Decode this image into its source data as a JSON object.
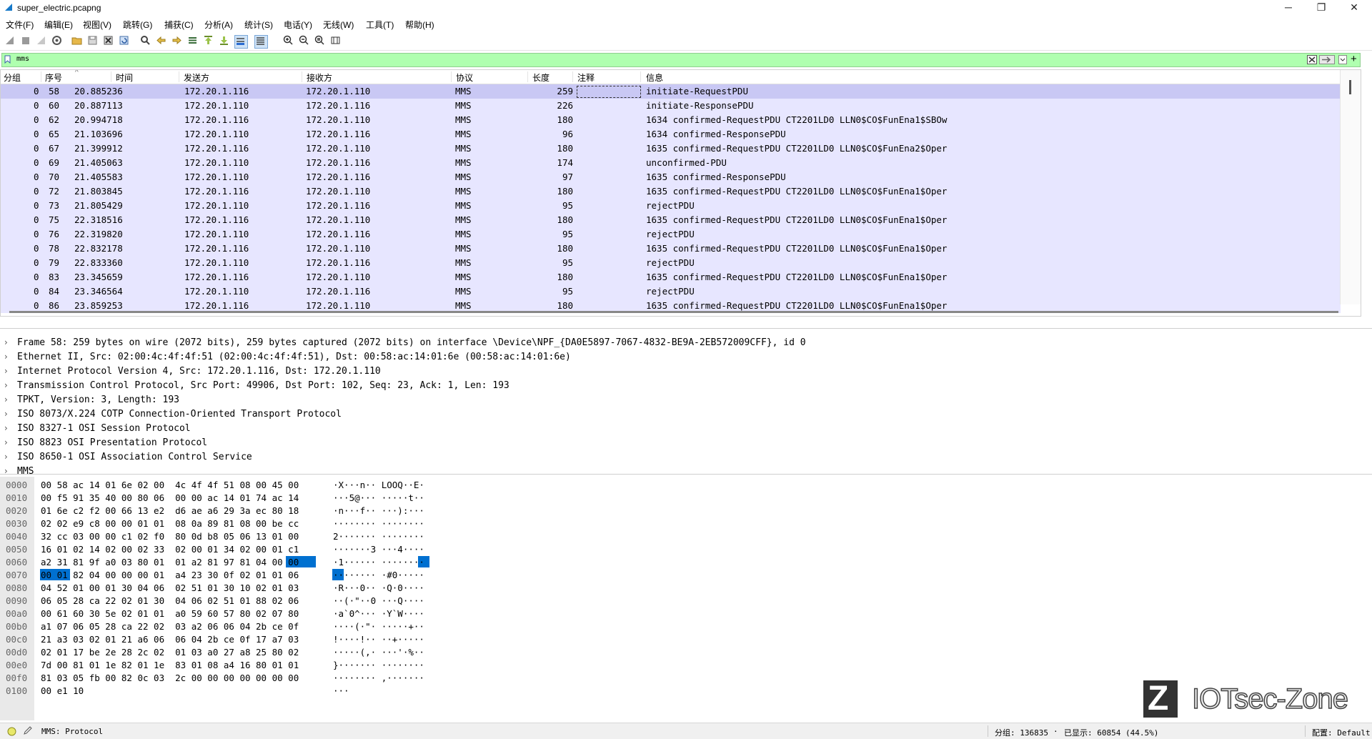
{
  "window": {
    "title": "super_electric.pcapng",
    "minimize": "─",
    "maximize": "❐",
    "close": "✕"
  },
  "menu": [
    "文件(F)",
    "编辑(E)",
    "视图(V)",
    "跳转(G)",
    "捕获(C)",
    "分析(A)",
    "统计(S)",
    "电话(Y)",
    "无线(W)",
    "工具(T)",
    "帮助(H)"
  ],
  "filter": {
    "value": "mms",
    "add": "+"
  },
  "packet_list": {
    "columns": [
      "分组",
      "序号",
      "时间",
      "发送方",
      "接收方",
      "协议",
      "长度",
      "注释",
      "信息"
    ],
    "sort_indicator": "^",
    "rows": [
      {
        "grp": "0",
        "no": "58",
        "time": "20.885236",
        "src": "172.20.1.116",
        "dst": "172.20.1.110",
        "proto": "MMS",
        "len": "259",
        "info": "initiate-RequestPDU"
      },
      {
        "grp": "0",
        "no": "60",
        "time": "20.887113",
        "src": "172.20.1.110",
        "dst": "172.20.1.116",
        "proto": "MMS",
        "len": "226",
        "info": "initiate-ResponsePDU"
      },
      {
        "grp": "0",
        "no": "62",
        "time": "20.994718",
        "src": "172.20.1.116",
        "dst": "172.20.1.110",
        "proto": "MMS",
        "len": "180",
        "info": "1634 confirmed-RequestPDU CT2201LD0 LLN0$CO$FunEna1$SBOw"
      },
      {
        "grp": "0",
        "no": "65",
        "time": "21.103696",
        "src": "172.20.1.110",
        "dst": "172.20.1.116",
        "proto": "MMS",
        "len": "96",
        "info": "1634 confirmed-ResponsePDU"
      },
      {
        "grp": "0",
        "no": "67",
        "time": "21.399912",
        "src": "172.20.1.116",
        "dst": "172.20.1.110",
        "proto": "MMS",
        "len": "180",
        "info": "1635 confirmed-RequestPDU CT2201LD0 LLN0$CO$FunEna2$Oper"
      },
      {
        "grp": "0",
        "no": "69",
        "time": "21.405063",
        "src": "172.20.1.110",
        "dst": "172.20.1.116",
        "proto": "MMS",
        "len": "174",
        "info": "unconfirmed-PDU"
      },
      {
        "grp": "0",
        "no": "70",
        "time": "21.405583",
        "src": "172.20.1.110",
        "dst": "172.20.1.116",
        "proto": "MMS",
        "len": "97",
        "info": "1635 confirmed-ResponsePDU"
      },
      {
        "grp": "0",
        "no": "72",
        "time": "21.803845",
        "src": "172.20.1.116",
        "dst": "172.20.1.110",
        "proto": "MMS",
        "len": "180",
        "info": "1635 confirmed-RequestPDU CT2201LD0 LLN0$CO$FunEna1$Oper"
      },
      {
        "grp": "0",
        "no": "73",
        "time": "21.805429",
        "src": "172.20.1.110",
        "dst": "172.20.1.116",
        "proto": "MMS",
        "len": "95",
        "info": "rejectPDU"
      },
      {
        "grp": "0",
        "no": "75",
        "time": "22.318516",
        "src": "172.20.1.116",
        "dst": "172.20.1.110",
        "proto": "MMS",
        "len": "180",
        "info": "1635 confirmed-RequestPDU CT2201LD0 LLN0$CO$FunEna1$Oper"
      },
      {
        "grp": "0",
        "no": "76",
        "time": "22.319820",
        "src": "172.20.1.110",
        "dst": "172.20.1.116",
        "proto": "MMS",
        "len": "95",
        "info": "rejectPDU"
      },
      {
        "grp": "0",
        "no": "78",
        "time": "22.832178",
        "src": "172.20.1.116",
        "dst": "172.20.1.110",
        "proto": "MMS",
        "len": "180",
        "info": "1635 confirmed-RequestPDU CT2201LD0 LLN0$CO$FunEna1$Oper"
      },
      {
        "grp": "0",
        "no": "79",
        "time": "22.833360",
        "src": "172.20.1.110",
        "dst": "172.20.1.116",
        "proto": "MMS",
        "len": "95",
        "info": "rejectPDU"
      },
      {
        "grp": "0",
        "no": "83",
        "time": "23.345659",
        "src": "172.20.1.116",
        "dst": "172.20.1.110",
        "proto": "MMS",
        "len": "180",
        "info": "1635 confirmed-RequestPDU CT2201LD0 LLN0$CO$FunEna1$Oper"
      },
      {
        "grp": "0",
        "no": "84",
        "time": "23.346564",
        "src": "172.20.1.110",
        "dst": "172.20.1.116",
        "proto": "MMS",
        "len": "95",
        "info": "rejectPDU"
      },
      {
        "grp": "0",
        "no": "86",
        "time": "23.859253",
        "src": "172.20.1.116",
        "dst": "172.20.1.110",
        "proto": "MMS",
        "len": "180",
        "info": "1635 confirmed-RequestPDU CT2201LD0 LLN0$CO$FunEna1$Oper"
      }
    ]
  },
  "details": [
    "Frame 58: 259 bytes on wire (2072 bits), 259 bytes captured (2072 bits) on interface \\Device\\NPF_{DA0E5897-7067-4832-BE9A-2EB572009CFF}, id 0",
    "Ethernet II, Src: 02:00:4c:4f:4f:51 (02:00:4c:4f:4f:51), Dst: 00:58:ac:14:01:6e (00:58:ac:14:01:6e)",
    "Internet Protocol Version 4, Src: 172.20.1.116, Dst: 172.20.1.110",
    "Transmission Control Protocol, Src Port: 49906, Dst Port: 102, Seq: 23, Ack: 1, Len: 193",
    "TPKT, Version: 3, Length: 193",
    "ISO 8073/X.224 COTP Connection-Oriented Transport Protocol",
    "ISO 8327-1 OSI Session Protocol",
    "ISO 8823 OSI Presentation Protocol",
    "ISO 8650-1 OSI Association Control Service",
    "MMS"
  ],
  "detail_arrow": "›",
  "bytes": [
    {
      "off": "0000",
      "hex": "00 58 ac 14 01 6e 02 00  4c 4f 4f 51 08 00 45 00",
      "asc": "·X···n·· LOOQ··E·"
    },
    {
      "off": "0010",
      "hex": "00 f5 91 35 40 00 80 06  00 00 ac 14 01 74 ac 14",
      "asc": "···5@··· ·····t··"
    },
    {
      "off": "0020",
      "hex": "01 6e c2 f2 00 66 13 e2  d6 ae a6 29 3a ec 80 18",
      "asc": "·n···f·· ···):···"
    },
    {
      "off": "0030",
      "hex": "02 02 e9 c8 00 00 01 01  08 0a 89 81 08 00 be cc",
      "asc": "········ ········"
    },
    {
      "off": "0040",
      "hex": "32 cc 03 00 00 c1 02 f0  80 0d b8 05 06 13 01 00",
      "asc": "2······· ········"
    },
    {
      "off": "0050",
      "hex": "16 01 02 14 02 00 02 33  02 00 01 34 02 00 01 c1",
      "asc": "·······3 ···4····"
    },
    {
      "off": "0060",
      "hex": "a2 31 81 9f a0 03 80 01  01 a2 81 97 81 04 00 00",
      "asc": "·1······ ········"
    },
    {
      "off": "0070",
      "hex": "00 01 82 04 00 00 00 01  a4 23 30 0f 02 01 01 06",
      "asc": "········ ·#0·····"
    },
    {
      "off": "0080",
      "hex": "04 52 01 00 01 30 04 06  02 51 01 30 10 02 01 03",
      "asc": "·R···0·· ·Q·0····"
    },
    {
      "off": "0090",
      "hex": "06 05 28 ca 22 02 01 30  04 06 02 51 01 88 02 06",
      "asc": "··(·\"··0 ···Q····"
    },
    {
      "off": "00a0",
      "hex": "00 61 60 30 5e 02 01 01  a0 59 60 57 80 02 07 80",
      "asc": "·a`0^··· ·Y`W····"
    },
    {
      "off": "00b0",
      "hex": "a1 07 06 05 28 ca 22 02  03 a2 06 06 04 2b ce 0f",
      "asc": "····(·\"· ·····+··"
    },
    {
      "off": "00c0",
      "hex": "21 a3 03 02 01 21 a6 06  06 04 2b ce 0f 17 a7 03",
      "asc": "!····!·· ··+·····"
    },
    {
      "off": "00d0",
      "hex": "02 01 17 be 2e 28 2c 02  01 03 a0 27 a8 25 80 02",
      "asc": "·····(,· ···'·%··"
    },
    {
      "off": "00e0",
      "hex": "7d 00 81 01 1e 82 01 1e  83 01 08 a4 16 80 01 01",
      "asc": "}······· ········"
    },
    {
      "off": "00f0",
      "hex": "81 03 05 fb 00 82 0c 03  2c 00 00 00 00 00 00 00",
      "asc": "········ ,·······"
    },
    {
      "off": "0100",
      "hex": "00 e1 10",
      "asc": "···"
    }
  ],
  "watermark": {
    "logo_letter": "Z",
    "text": "IOTsec-Zone"
  },
  "status": {
    "protocol": "MMS: Protocol",
    "packets": "分组: 136835",
    "displayed": "已显示: 60854 (44.5%)",
    "profile": "配置: Default"
  },
  "colors": {
    "row_bg": "#e7e6ff",
    "row_selected": "#c9c8f4",
    "filter_bg": "#afffaf",
    "byte_highlight": "#0070d0"
  }
}
